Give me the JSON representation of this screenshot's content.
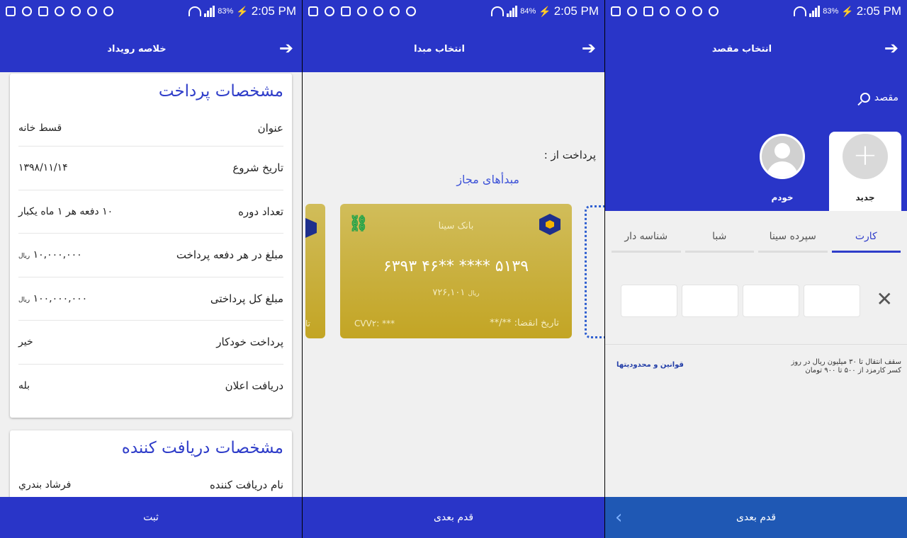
{
  "statusbars": [
    {
      "time": "2:05 PM",
      "battery": "83%"
    },
    {
      "time": "2:05 PM",
      "battery": "84%"
    },
    {
      "time": "2:05 PM",
      "battery": "83%"
    }
  ],
  "summary": {
    "title": "خلاصه رویداد",
    "payment_section_title": "مشخصات پرداخت",
    "rows": [
      {
        "label": "عنوان",
        "value": "قسط خانه",
        "unit": ""
      },
      {
        "label": "تاریخ شروع",
        "value": "۱۳۹۸/۱۱/۱۴",
        "unit": ""
      },
      {
        "label": "تعداد دوره",
        "value": "۱۰ دفعه هر ۱ ماه یکبار",
        "unit": ""
      },
      {
        "label": "مبلغ در هر دفعه پرداخت",
        "value": "۱۰,۰۰۰,۰۰۰",
        "unit": "ریال"
      },
      {
        "label": "مبلغ کل پرداختی",
        "value": "۱۰۰,۰۰۰,۰۰۰",
        "unit": "ریال"
      },
      {
        "label": "پرداخت خودکار",
        "value": "خیر",
        "unit": ""
      },
      {
        "label": "دریافت اعلان",
        "value": "بله",
        "unit": ""
      }
    ],
    "receiver_section_title": "مشخصات دریافت کننده",
    "receiver_rows": [
      {
        "label": "نام دریافت کننده",
        "value": "فرشاد بندري"
      }
    ],
    "submit_label": "ثبت"
  },
  "source": {
    "title": "انتخاب مبدا",
    "pay_from_label": "پرداخت از :",
    "allowed_sources_label": "مبدأهای مجاز",
    "card": {
      "bank_name": "بانک سینا",
      "number": "۶۳۹۳ ۴۶** **** ۵۱۳۹",
      "balance": "۷۲۶,۱۰۱",
      "balance_unit": "ریال",
      "cvv": "CVV۲: ***",
      "expiry": "تاریخ انقضا: **/**",
      "link_icon": "link-icon"
    },
    "side_card_fragment": "تا",
    "next_label": "قدم بعدی"
  },
  "destination": {
    "title": "انتخاب مقصد",
    "search_label": "مقصد",
    "new_label": "جدید",
    "self_label": "خودم",
    "tabs": [
      "کارت",
      "سپرده سینا",
      "شبا",
      "شناسه دار"
    ],
    "active_tab": 0,
    "limits_line1": "سقف انتقال تا ۳۰ میلیون ریال در روز",
    "limits_line2": "کسر کارمزد از ۵۰۰ تا ۹۰۰ تومان",
    "rules_label": "قوانین و محدودیتها",
    "next_label": "قدم بعدی"
  },
  "colors": {
    "primary": "#2935c8",
    "accent_text": "#2f3dc9",
    "card_gold": "#c8ae3a",
    "bottom_bar_3": "#1f58b4"
  }
}
